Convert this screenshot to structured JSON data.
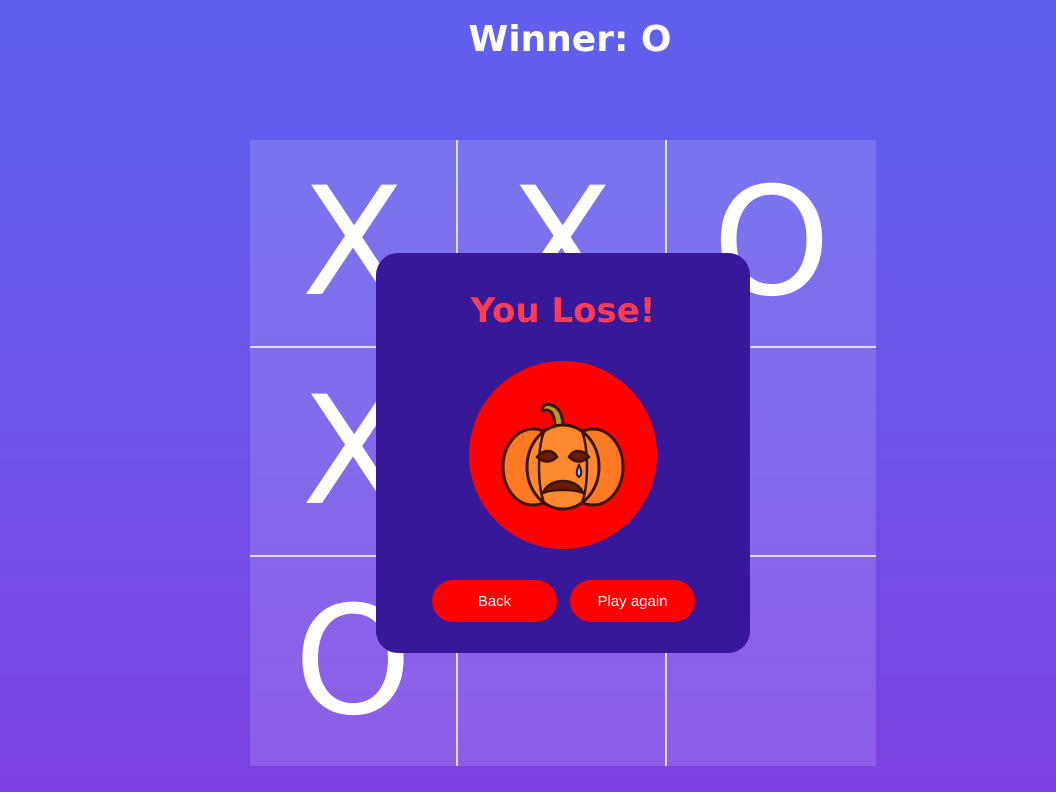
{
  "header": {
    "title": "Winner: O"
  },
  "board": {
    "cells": [
      "X",
      "X",
      "O",
      "X",
      "",
      "",
      "O",
      "",
      ""
    ]
  },
  "modal": {
    "title": "You Lose!",
    "icon": "crying-pumpkin-icon",
    "back_label": "Back",
    "play_again_label": "Play again"
  },
  "colors": {
    "background_top": "#5f60ef",
    "background_bottom": "#7b42e2",
    "modal_bg": "#371899",
    "accent_red": "#ff0000",
    "lose_text": "#ff3b55"
  }
}
